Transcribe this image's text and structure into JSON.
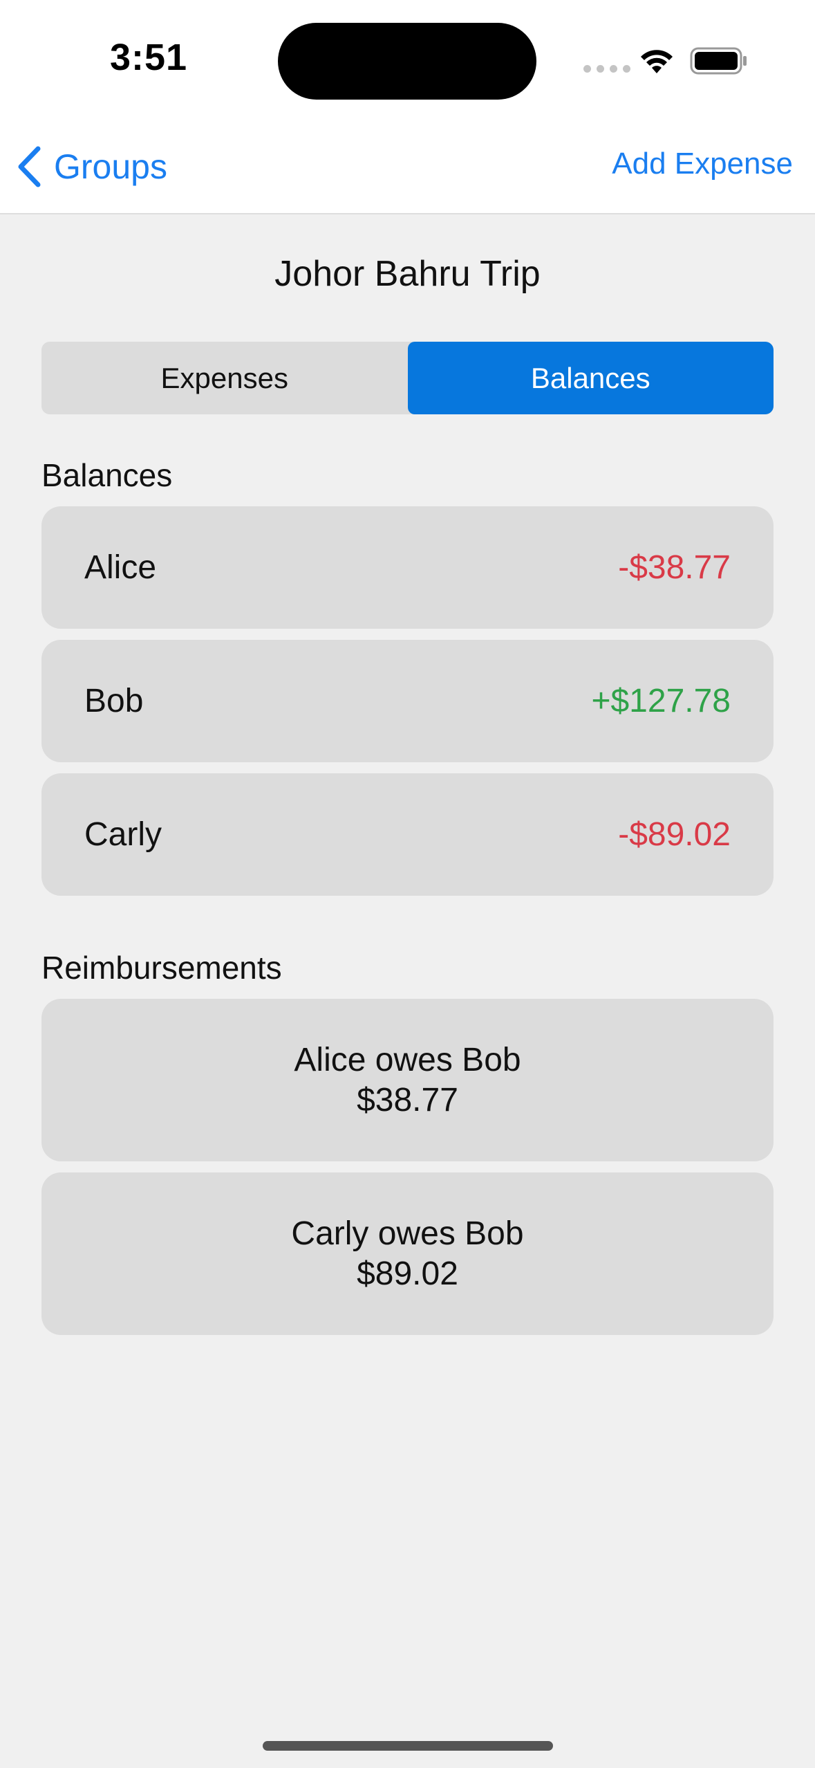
{
  "status_bar": {
    "time": "3:51"
  },
  "nav": {
    "back_label": "Groups",
    "action_label": "Add Expense"
  },
  "page": {
    "title": "Johor Bahru Trip"
  },
  "tabs": [
    {
      "label": "Expenses",
      "selected": false
    },
    {
      "label": "Balances",
      "selected": true
    }
  ],
  "balances": {
    "title": "Balances",
    "items": [
      {
        "name": "Alice",
        "amount": "-$38.77"
      },
      {
        "name": "Bob",
        "amount": "+$127.78"
      },
      {
        "name": "Carly",
        "amount": "-$89.02"
      }
    ]
  },
  "reimbursements": {
    "title": "Reimbursements",
    "items": [
      {
        "text": "Alice owes Bob",
        "amount": "$38.77"
      },
      {
        "text": "Carly owes Bob",
        "amount": "$89.02"
      }
    ]
  },
  "colors": {
    "accent": "#0777dd",
    "link": "#1a7ef0",
    "negative": "#d93a47",
    "positive": "#2ea248",
    "card": "#dcdcdc",
    "background": "#f0f0f0"
  },
  "icons": {
    "back": "chevron-left-icon",
    "wifi": "wifi-icon",
    "battery": "battery-icon",
    "signal": "cellular-signal-icon"
  }
}
